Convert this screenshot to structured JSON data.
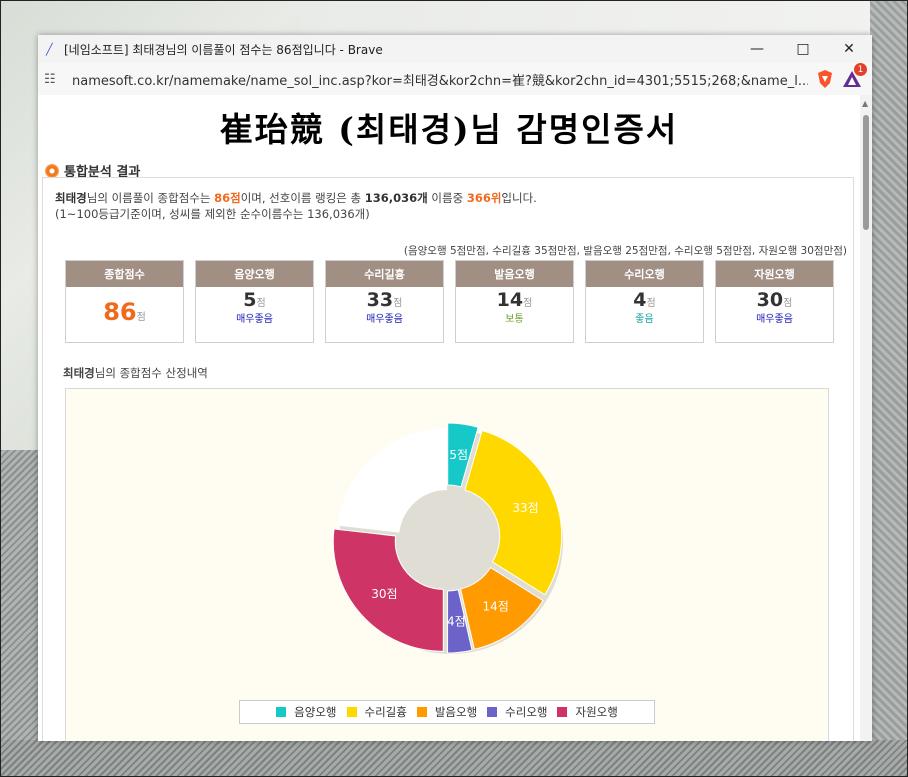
{
  "window": {
    "title": "[네임소프트] 최태경님의 이름풀이 점수는 86점입니다 - Brave",
    "url": "namesoft.co.kr/namemake/name_sol_inc.asp?kor=최태경&kor2chn=崔?競&kor2chn_id=4301;5515;268;&name_l...",
    "minimize_icon": "minimize-icon",
    "maximize_icon": "maximize-icon",
    "close_icon": "close-icon",
    "notification_count": "1"
  },
  "page": {
    "title": "崔珆競 (최태경)님 감명인증서",
    "section_title": "통합분석 결과"
  },
  "summary": {
    "name": "최태경",
    "t1": "님의 이름풀이 종합점수는 ",
    "score": "86점",
    "t2": "이며, 선호이름 랭킹은 총 ",
    "total_count": "136,036개",
    "t3": " 이름중 ",
    "rank": "366위",
    "t4": "입니다.",
    "line2": "(1~100등급기준이며, 성씨를 제외한 순수이름수는 136,036개)",
    "note": "(음양오행 5점만점, 수리길흉 35점만점, 발음오행 25점만점, 수리오행 5점만점, 자원오행 30점만점)"
  },
  "cards": [
    {
      "label": "종합점수",
      "score": "86",
      "unit": "점",
      "grade": ""
    },
    {
      "label": "음양오행",
      "score": "5",
      "unit": "점",
      "grade": "매우좋음",
      "grade_color": "#1a1ab8"
    },
    {
      "label": "수리길흉",
      "score": "33",
      "unit": "점",
      "grade": "매우좋음",
      "grade_color": "#1a1ab8"
    },
    {
      "label": "발음오행",
      "score": "14",
      "unit": "점",
      "grade": "보통",
      "grade_color": "#6aa02a"
    },
    {
      "label": "수리오행",
      "score": "4",
      "unit": "점",
      "grade": "좋음",
      "grade_color": "#17a3a3"
    },
    {
      "label": "자원오행",
      "score": "30",
      "unit": "점",
      "grade": "매우좋음",
      "grade_color": "#1a1ab8"
    }
  ],
  "chart_caption": {
    "name": "최태경",
    "text": "님의 종합점수 산정내역"
  },
  "chart_data": {
    "type": "pie",
    "total": 112,
    "slices": [
      {
        "name": "음양오행",
        "value": 5,
        "label": "5점",
        "color": "#17c8c8"
      },
      {
        "name": "수리길흉",
        "value": 33,
        "label": "33점",
        "color": "#ffd800"
      },
      {
        "name": "발음오행",
        "value": 14,
        "label": "14점",
        "color": "#ff9a00"
      },
      {
        "name": "수리오행",
        "value": 4,
        "label": "4점",
        "color": "#6b63c9"
      },
      {
        "name": "자원오행",
        "value": 30,
        "label": "30점",
        "color": "#cf3466"
      }
    ],
    "remainder_color": "#ffffff",
    "legend_position": "bottom"
  }
}
